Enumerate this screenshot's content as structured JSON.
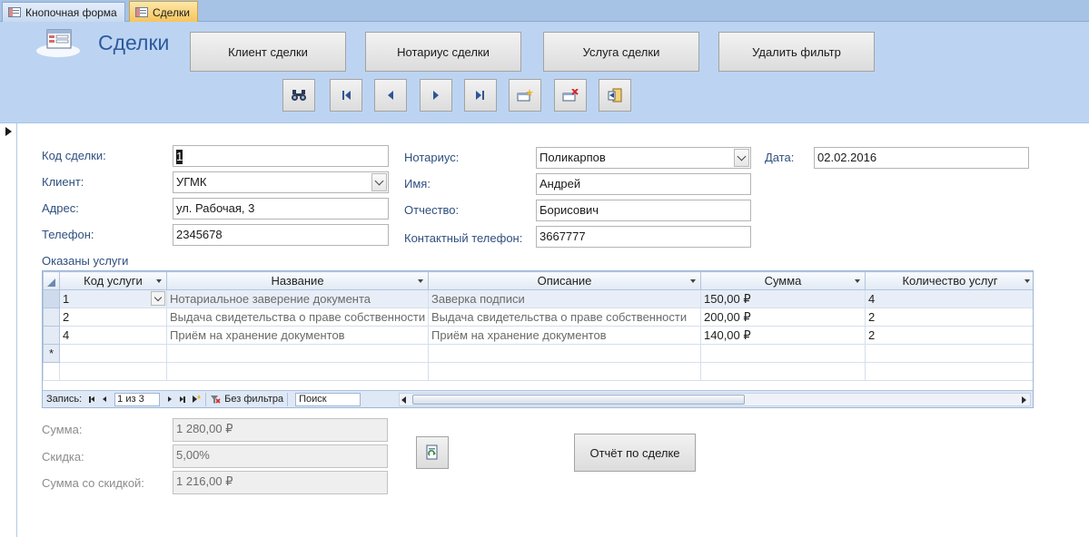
{
  "tabs": [
    {
      "label": "Кнопочная форма",
      "active": false
    },
    {
      "label": "Сделки",
      "active": true
    }
  ],
  "form": {
    "title": "Сделки",
    "buttons": {
      "client": "Клиент сделки",
      "notary": "Нотариус сделки",
      "service": "Услуга сделки",
      "remove_filter": "Удалить фильтр",
      "report": "Отчёт по сделке"
    },
    "nav_icons": [
      "binoculars-icon",
      "first-record-icon",
      "previous-record-icon",
      "next-record-icon",
      "last-record-icon",
      "new-record-icon",
      "delete-record-icon",
      "close-form-icon"
    ]
  },
  "fields": {
    "deal_code": {
      "label": "Код сделки:",
      "value": "1"
    },
    "client": {
      "label": "Клиент:",
      "value": "УГМК"
    },
    "address": {
      "label": "Адрес:",
      "value": "ул. Рабочая, 3"
    },
    "phone": {
      "label": "Телефон:",
      "value": "2345678"
    },
    "notary": {
      "label": "Нотариус:",
      "value": "Поликарпов"
    },
    "first_name": {
      "label": "Имя:",
      "value": "Андрей"
    },
    "patronymic": {
      "label": "Отчество:",
      "value": "Борисович"
    },
    "contact_phone": {
      "label": "Контактный телефон:",
      "value": "3667777"
    },
    "date": {
      "label": "Дата:",
      "value": "02.02.2016"
    }
  },
  "subform": {
    "caption": "Оказаны услуги",
    "columns": [
      "Код услуги",
      "Название",
      "Описание",
      "Сумма",
      "Количество услуг"
    ],
    "rows": [
      [
        "1",
        "Нотариальное заверение документа",
        "Заверка подписи",
        "150,00 ₽",
        "4"
      ],
      [
        "2",
        "Выдача свидетельства о праве собственности",
        "Выдача свидетельства о праве собственности",
        "200,00 ₽",
        "2"
      ],
      [
        "4",
        "Приём на хранение документов",
        "Приём на хранение документов",
        "140,00 ₽",
        "2"
      ]
    ],
    "new_row_marker": "*",
    "navigation": {
      "record_label": "Запись:",
      "position": "1 из 3",
      "filter_label": "Без фильтра",
      "search_placeholder": "Поиск"
    }
  },
  "totals": {
    "sum": {
      "label": "Сумма:",
      "value": "1 280,00 ₽"
    },
    "discount": {
      "label": "Скидка:",
      "value": "5,00%"
    },
    "sum_discounted": {
      "label": "Сумма со скидкой:",
      "value": "1 216,00 ₽"
    }
  },
  "colors": {
    "header_band": "#bcd4f2",
    "tab_strip": "#a6c3e6",
    "active_tab": "#f6c35a",
    "label_text": "#2f4f7f",
    "title_text": "#2e5a9c"
  }
}
